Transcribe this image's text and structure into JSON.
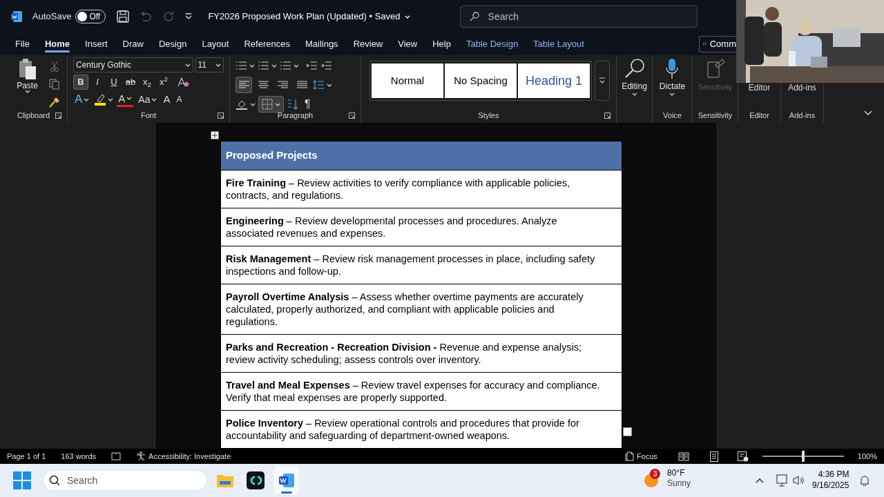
{
  "title_bar": {
    "autosave_label": "AutoSave",
    "autosave": {
      "on": false,
      "label": "Off"
    },
    "document_title": "FY2026 Proposed Work Plan (Updated) • Saved",
    "search": {
      "placeholder": "Search"
    }
  },
  "tabs": [
    {
      "label": "File",
      "selected": false,
      "kind": "normal"
    },
    {
      "label": "Home",
      "selected": true,
      "kind": "normal"
    },
    {
      "label": "Insert",
      "selected": false,
      "kind": "normal"
    },
    {
      "label": "Draw",
      "selected": false,
      "kind": "normal"
    },
    {
      "label": "Design",
      "selected": false,
      "kind": "normal"
    },
    {
      "label": "Layout",
      "selected": false,
      "kind": "normal"
    },
    {
      "label": "References",
      "selected": false,
      "kind": "normal"
    },
    {
      "label": "Mailings",
      "selected": false,
      "kind": "normal"
    },
    {
      "label": "Review",
      "selected": false,
      "kind": "normal"
    },
    {
      "label": "View",
      "selected": false,
      "kind": "normal"
    },
    {
      "label": "Help",
      "selected": false,
      "kind": "normal"
    },
    {
      "label": "Table Design",
      "selected": false,
      "kind": "contextual"
    },
    {
      "label": "Table Layout",
      "selected": false,
      "kind": "contextual"
    }
  ],
  "comments_button": "Comm",
  "ribbon": {
    "clipboard": {
      "paste": "Paste",
      "label": "Clipboard"
    },
    "font": {
      "name": "Century Gothic",
      "size": "11",
      "label": "Font",
      "format_buttons": [
        {
          "label": "B",
          "active": true
        },
        {
          "label": "I",
          "active": false
        },
        {
          "label": "U",
          "active": false
        },
        {
          "label": "ab",
          "active": false
        },
        {
          "label": "x$_{2}$",
          "active": false
        },
        {
          "label": "x$^{2}$",
          "active": false
        }
      ],
      "effects_buttons": [
        "A",
        "A",
        "Aa",
        "A",
        "A"
      ]
    },
    "paragraph": {
      "label": "Paragraph",
      "alignment": [
        {
          "selected": true
        },
        {
          "selected": false
        },
        {
          "selected": false
        },
        {
          "selected": false
        }
      ],
      "borders_active": true,
      "pilcrow": "¶"
    },
    "styles": {
      "label": "Styles",
      "items": [
        {
          "label": "Normal",
          "kind": "normal"
        },
        {
          "label": "No Spacing",
          "kind": "normal"
        },
        {
          "label": "Heading 1",
          "kind": "heading"
        }
      ]
    },
    "editing": {
      "label": "Editing"
    },
    "voice": {
      "button": "Dictate",
      "label": "Voice"
    },
    "sensitivity": {
      "button": "Sensitivity",
      "disabled": true,
      "label": "Sensitivity"
    },
    "editor": {
      "button": "Editor",
      "label": "Editor"
    },
    "addins": {
      "button": "Add-ins",
      "label": "Add-ins"
    }
  },
  "table": {
    "header": "Proposed Projects",
    "rows": [
      "**Fire Training** – Review activities to verify compliance with applicable policies, contracts, and regulations.",
      "**Engineering** – Review developmental processes and procedures. Analyze associated revenues and expenses.",
      "**Risk Management** – Review risk management processes in place, including safety inspections and follow-up.",
      "**Payroll Overtime Analysis** – Assess whether overtime payments are accurately calculated, properly authorized, and compliant with applicable policies and regulations.",
      "**Parks and Recreation - Recreation Division -** Revenue and expense analysis; review activity scheduling; assess controls over inventory.",
      "**Travel and Meal Expenses** – Review travel expenses for accuracy and compliance. Verify that meal expenses are properly supported.",
      "**Police Inventory** – Review operational controls and procedures that provide for accountability and safeguarding of department-owned weapons."
    ]
  },
  "status_bar": {
    "page": "Page 1 of 1",
    "words": "163 words",
    "accessibility": "Accessibility: Investigate",
    "focus": "Focus",
    "zoom": {
      "level": 0.5,
      "label": "100%"
    }
  },
  "taskbar": {
    "search": {
      "placeholder": "Search"
    },
    "weather": {
      "badge": "3",
      "temperature": "80°F",
      "condition": "Sunny"
    },
    "time": "4:36 PM",
    "date": "9/16/2025"
  }
}
